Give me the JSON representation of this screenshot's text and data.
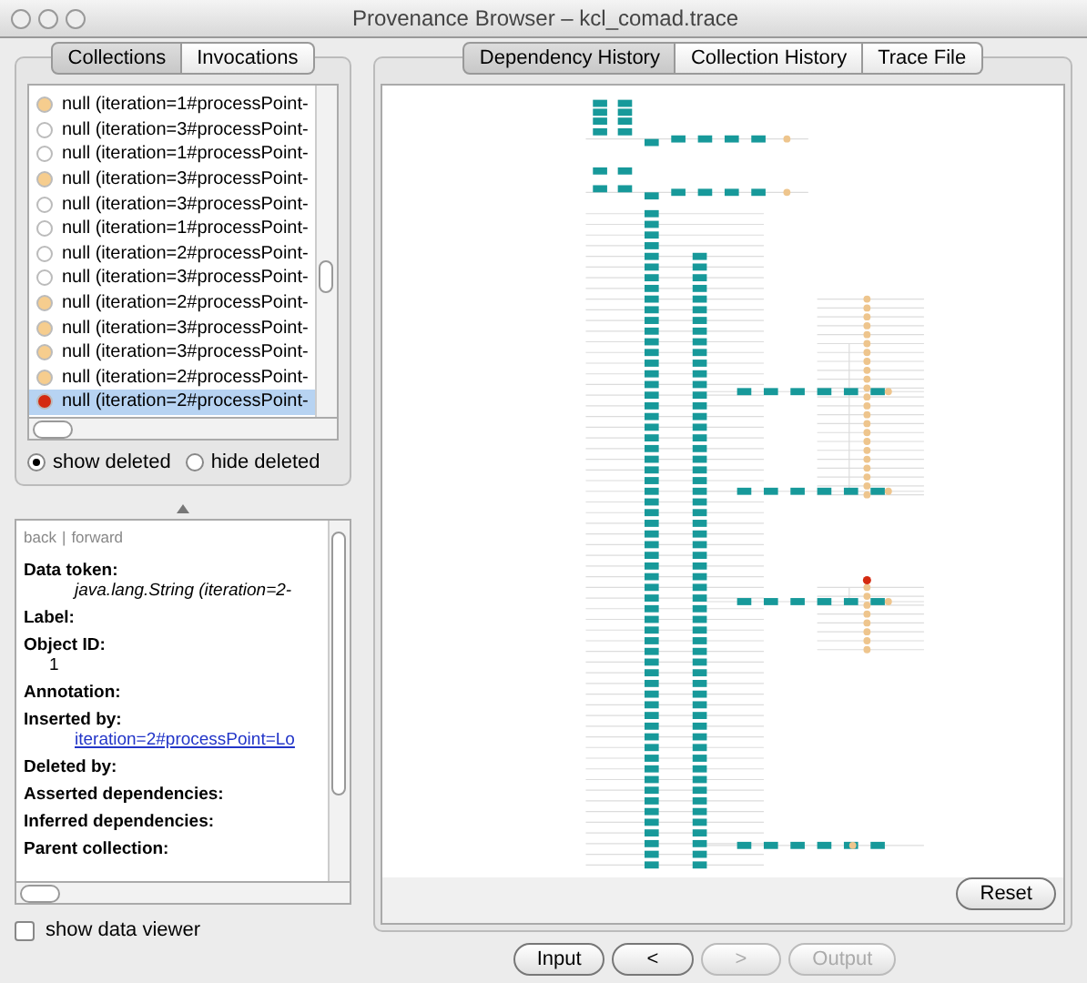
{
  "window": {
    "title": "Provenance Browser – kcl_comad.trace"
  },
  "left_tabs": [
    {
      "label": "Collections",
      "selected": true
    },
    {
      "label": "Invocations",
      "selected": false
    }
  ],
  "collections": [
    {
      "label": "null (iteration=1#processPoint-",
      "color": "#f6cd8e",
      "selected": false
    },
    {
      "label": "null (iteration=3#processPoint-",
      "color": "#ffffff",
      "selected": false
    },
    {
      "label": "null (iteration=1#processPoint-",
      "color": "#ffffff",
      "selected": false
    },
    {
      "label": "null (iteration=3#processPoint-",
      "color": "#f6cd8e",
      "selected": false
    },
    {
      "label": "null (iteration=3#processPoint-",
      "color": "#ffffff",
      "selected": false
    },
    {
      "label": "null (iteration=1#processPoint-",
      "color": "#ffffff",
      "selected": false
    },
    {
      "label": "null (iteration=2#processPoint-",
      "color": "#ffffff",
      "selected": false
    },
    {
      "label": "null (iteration=3#processPoint-",
      "color": "#ffffff",
      "selected": false
    },
    {
      "label": "null (iteration=2#processPoint-",
      "color": "#f6cd8e",
      "selected": false
    },
    {
      "label": "null (iteration=3#processPoint-",
      "color": "#f6cd8e",
      "selected": false
    },
    {
      "label": "null (iteration=3#processPoint-",
      "color": "#f6cd8e",
      "selected": false
    },
    {
      "label": "null (iteration=2#processPoint-",
      "color": "#f6cd8e",
      "selected": false
    },
    {
      "label": "null (iteration=2#processPoint-",
      "color": "#d42a10",
      "selected": true
    }
  ],
  "deleted_filter": [
    {
      "label": "show deleted",
      "selected": true
    },
    {
      "label": "hide deleted",
      "selected": false
    }
  ],
  "details": {
    "nav": [
      "back",
      "|",
      "forward"
    ],
    "fields": [
      {
        "label": "Data token:",
        "value": "java.lang.String (iteration=2-",
        "kind": "italic"
      },
      {
        "label": "Label:"
      },
      {
        "label": "Object ID:",
        "value": "1",
        "kind": "text"
      },
      {
        "label": "Annotation:"
      },
      {
        "label": "Inserted by:",
        "value": "iteration=2#processPoint=Lo",
        "kind": "link"
      },
      {
        "label": "Deleted by:"
      },
      {
        "label": "Asserted dependencies:"
      },
      {
        "label": "Inferred dependencies:"
      },
      {
        "label": "Parent collection:"
      }
    ]
  },
  "show_data_viewer": {
    "label": "show data viewer",
    "checked": false
  },
  "right_tabs": [
    {
      "label": "Dependency History",
      "selected": true
    },
    {
      "label": "Collection History",
      "selected": false
    },
    {
      "label": "Trace File",
      "selected": false
    }
  ],
  "reset_button": "Reset",
  "nav_buttons": [
    {
      "label": "Input",
      "disabled": false
    },
    {
      "label": "<",
      "disabled": false
    },
    {
      "label": ">",
      "disabled": true
    },
    {
      "label": "Output",
      "disabled": true
    }
  ]
}
